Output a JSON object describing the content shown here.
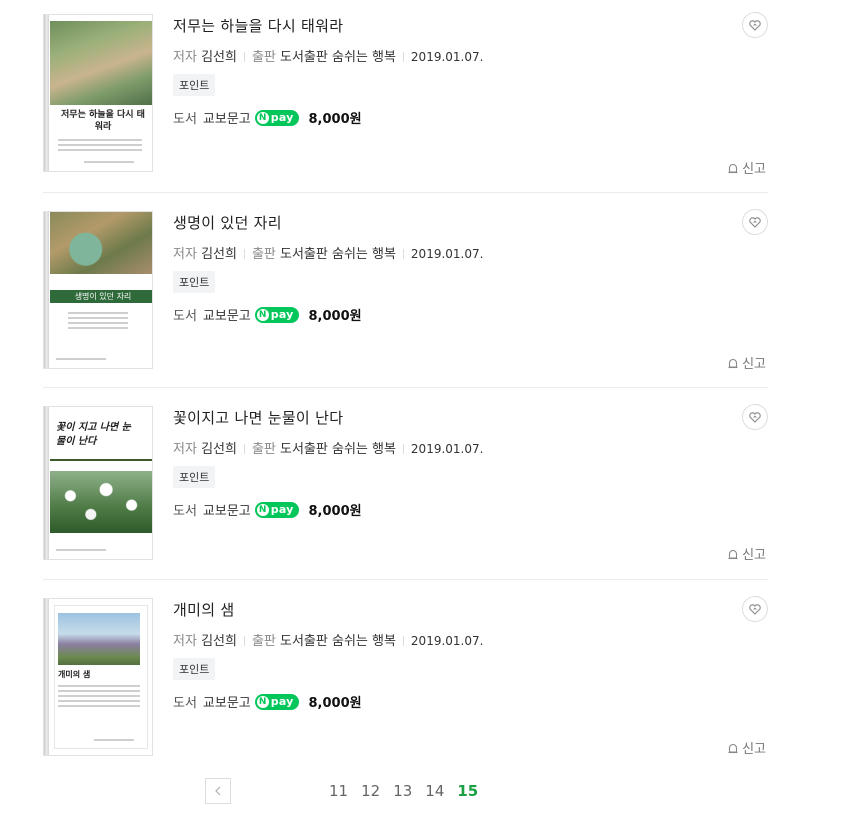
{
  "books": [
    {
      "title": "저무는 하늘을 다시 태워라",
      "author_label": "저자",
      "author": "김선희",
      "publisher_label": "출판",
      "publisher": "도서출판 숨쉬는 행복",
      "date": "2019.01.07.",
      "badge": "포인트",
      "type_label": "도서",
      "mall": "교보문고",
      "npay_label": "pay",
      "price": "8,000원",
      "report_label": "신고",
      "cover_title": "저무는 하늘을 다시 태워라"
    },
    {
      "title": "생명이 있던 자리",
      "author_label": "저자",
      "author": "김선희",
      "publisher_label": "출판",
      "publisher": "도서출판 숨쉬는 행복",
      "date": "2019.01.07.",
      "badge": "포인트",
      "type_label": "도서",
      "mall": "교보문고",
      "npay_label": "pay",
      "price": "8,000원",
      "report_label": "신고",
      "cover_title": "생명이 있던 자리"
    },
    {
      "title": "꽃이지고 나면 눈물이 난다",
      "author_label": "저자",
      "author": "김선희",
      "publisher_label": "출판",
      "publisher": "도서출판 숨쉬는 행복",
      "date": "2019.01.07.",
      "badge": "포인트",
      "type_label": "도서",
      "mall": "교보문고",
      "npay_label": "pay",
      "price": "8,000원",
      "report_label": "신고",
      "cover_title": "꽃이 지고 나면 눈물이 난다"
    },
    {
      "title": "개미의 샘",
      "author_label": "저자",
      "author": "김선희",
      "publisher_label": "출판",
      "publisher": "도서출판 숨쉬는 행복",
      "date": "2019.01.07.",
      "badge": "포인트",
      "type_label": "도서",
      "mall": "교보문고",
      "npay_label": "pay",
      "price": "8,000원",
      "report_label": "신고",
      "cover_title": "개미의 샘"
    }
  ],
  "pagination": {
    "pages": [
      "11",
      "12",
      "13",
      "14",
      "15"
    ],
    "current": "15"
  },
  "colors": {
    "npay_green": "#03c75a",
    "current_page": "#1aa043"
  }
}
